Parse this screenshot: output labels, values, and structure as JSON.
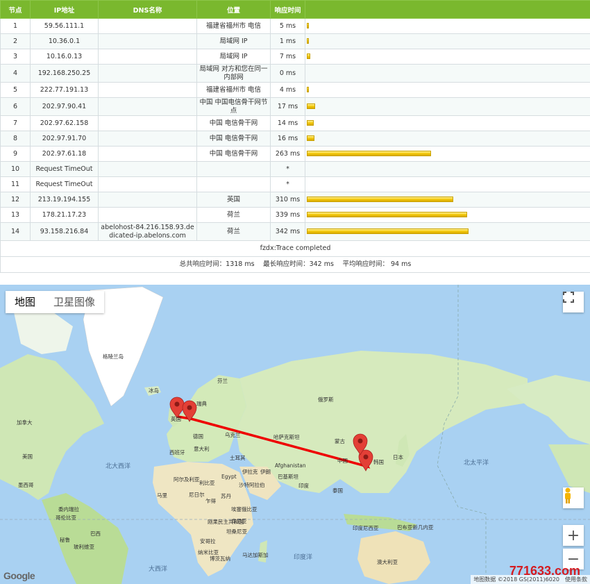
{
  "headers": [
    "节点",
    "IP地址",
    "DNS名称",
    "位置",
    "响应时间",
    ""
  ],
  "rows": [
    {
      "node": "1",
      "ip": "59.56.111.1",
      "dns": "",
      "location": "福建省福州市 电信",
      "time": "5 ms",
      "ms": 5
    },
    {
      "node": "2",
      "ip": "10.36.0.1",
      "dns": "",
      "location": "局域网 IP",
      "time": "1 ms",
      "ms": 1
    },
    {
      "node": "3",
      "ip": "10.16.0.13",
      "dns": "",
      "location": "局域网 IP",
      "time": "7 ms",
      "ms": 7
    },
    {
      "node": "4",
      "ip": "192.168.250.25",
      "dns": "",
      "location": "局域网 对方和您在同一内部网",
      "time": "0 ms",
      "ms": 0
    },
    {
      "node": "5",
      "ip": "222.77.191.13",
      "dns": "",
      "location": "福建省福州市 电信",
      "time": "4 ms",
      "ms": 4
    },
    {
      "node": "6",
      "ip": "202.97.90.41",
      "dns": "",
      "location": "中国 中国电信骨干网节点",
      "time": "17 ms",
      "ms": 17
    },
    {
      "node": "7",
      "ip": "202.97.62.158",
      "dns": "",
      "location": "中国 电信骨干网",
      "time": "14 ms",
      "ms": 14
    },
    {
      "node": "8",
      "ip": "202.97.91.70",
      "dns": "",
      "location": "中国 电信骨干网",
      "time": "16 ms",
      "ms": 16
    },
    {
      "node": "9",
      "ip": "202.97.61.18",
      "dns": "",
      "location": "中国 电信骨干网",
      "time": "263 ms",
      "ms": 263
    },
    {
      "node": "10",
      "ip": "Request TimeOut",
      "dns": "",
      "location": "",
      "time": "*",
      "ms": 0
    },
    {
      "node": "11",
      "ip": "Request TimeOut",
      "dns": "",
      "location": "",
      "time": "*",
      "ms": 0
    },
    {
      "node": "12",
      "ip": "213.19.194.155",
      "dns": "",
      "location": "英国",
      "time": "310 ms",
      "ms": 310
    },
    {
      "node": "13",
      "ip": "178.21.17.23",
      "dns": "",
      "location": "荷兰",
      "time": "339 ms",
      "ms": 339
    },
    {
      "node": "14",
      "ip": "93.158.216.84",
      "dns": "abelohost-84.216.158.93.dedicated-ip.abelons.com",
      "location": "荷兰",
      "time": "342 ms",
      "ms": 342
    }
  ],
  "status": "fzdx:Trace completed",
  "summary": "总共响应时间：1318 ms　 最长响应时间：342 ms　 平均响应时间： 94 ms",
  "map": {
    "type_map": "地图",
    "type_satellite": "卫星图像",
    "google_logo": "Google",
    "attribution": "地图数据 ©2018 GS(2011)6020　使用条款",
    "watermark": "771633.com",
    "labels": {
      "greenland": "格陵兰岛",
      "iceland": "冰岛",
      "finland": "芬兰",
      "sweden": "瑞典",
      "russia": "俄罗斯",
      "canada": "加拿大",
      "usa": "美国",
      "mexico": "墨西哥",
      "uk": "英国",
      "germany": "德国",
      "ukraine": "乌克兰",
      "spain": "西班牙",
      "italy": "意大利",
      "kazakhstan": "哈萨克斯坦",
      "mongolia": "蒙古",
      "china": "中国",
      "korea": "韩国",
      "japan": "日本",
      "turkey": "土耳其",
      "iran": "伊朗",
      "afghanistan": "Afghanistan",
      "pakistan": "巴基斯坦",
      "india": "印度",
      "iraq": "伊拉克",
      "saudi": "沙特阿拉伯",
      "egypt": "Egypt",
      "libya": "利比亚",
      "algeria": "阿尔及利亚",
      "mali": "马里",
      "niger": "尼日尔",
      "chad": "乍得",
      "sudan": "苏丹",
      "ethiopia": "埃塞俄比亚",
      "kenya": "肯尼亚",
      "drc": "刚果民主共和国",
      "tanzania": "坦桑尼亚",
      "angola": "安哥拉",
      "namibia": "纳米比亚",
      "botswana": "博茨瓦纳",
      "madagascar": "马达加斯加",
      "thailand": "泰国",
      "indonesia": "印度尼西亚",
      "png": "巴布亚新几内亚",
      "australia": "澳大利亚",
      "venezuela": "委内瑞拉",
      "colombia": "哥伦比亚",
      "peru": "秘鲁",
      "brazil": "巴西",
      "bolivia": "玻利维亚",
      "n_atlantic": "北大西洋",
      "n_pacific": "北太平洋",
      "atlantic": "大西洋",
      "indian": "印度洋"
    }
  }
}
